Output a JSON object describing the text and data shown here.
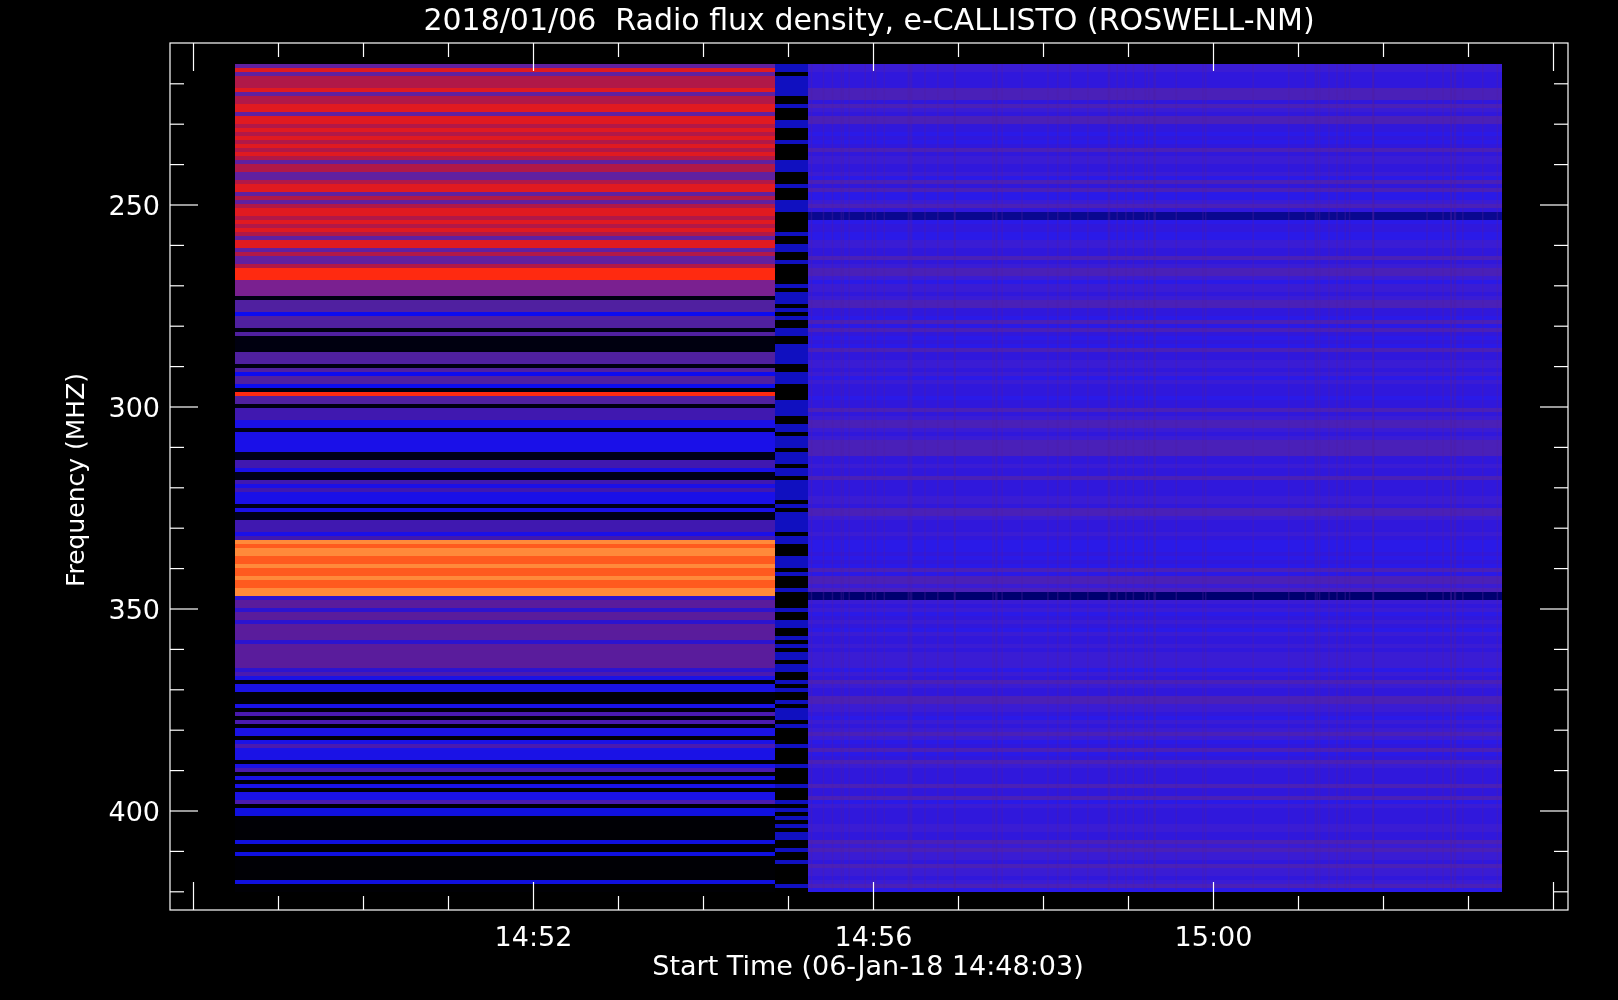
{
  "title": "2018/01/06  Radio flux density, e-CALLISTO (ROSWELL-NM)",
  "y_axis": {
    "label": "Frequency (MHZ)",
    "ticks": [
      "250",
      "300",
      "350",
      "400"
    ]
  },
  "x_axis": {
    "label": "Start Time (06-Jan-18 14:48:03)",
    "ticks": [
      "14:52",
      "14:56",
      "15:00"
    ]
  }
}
